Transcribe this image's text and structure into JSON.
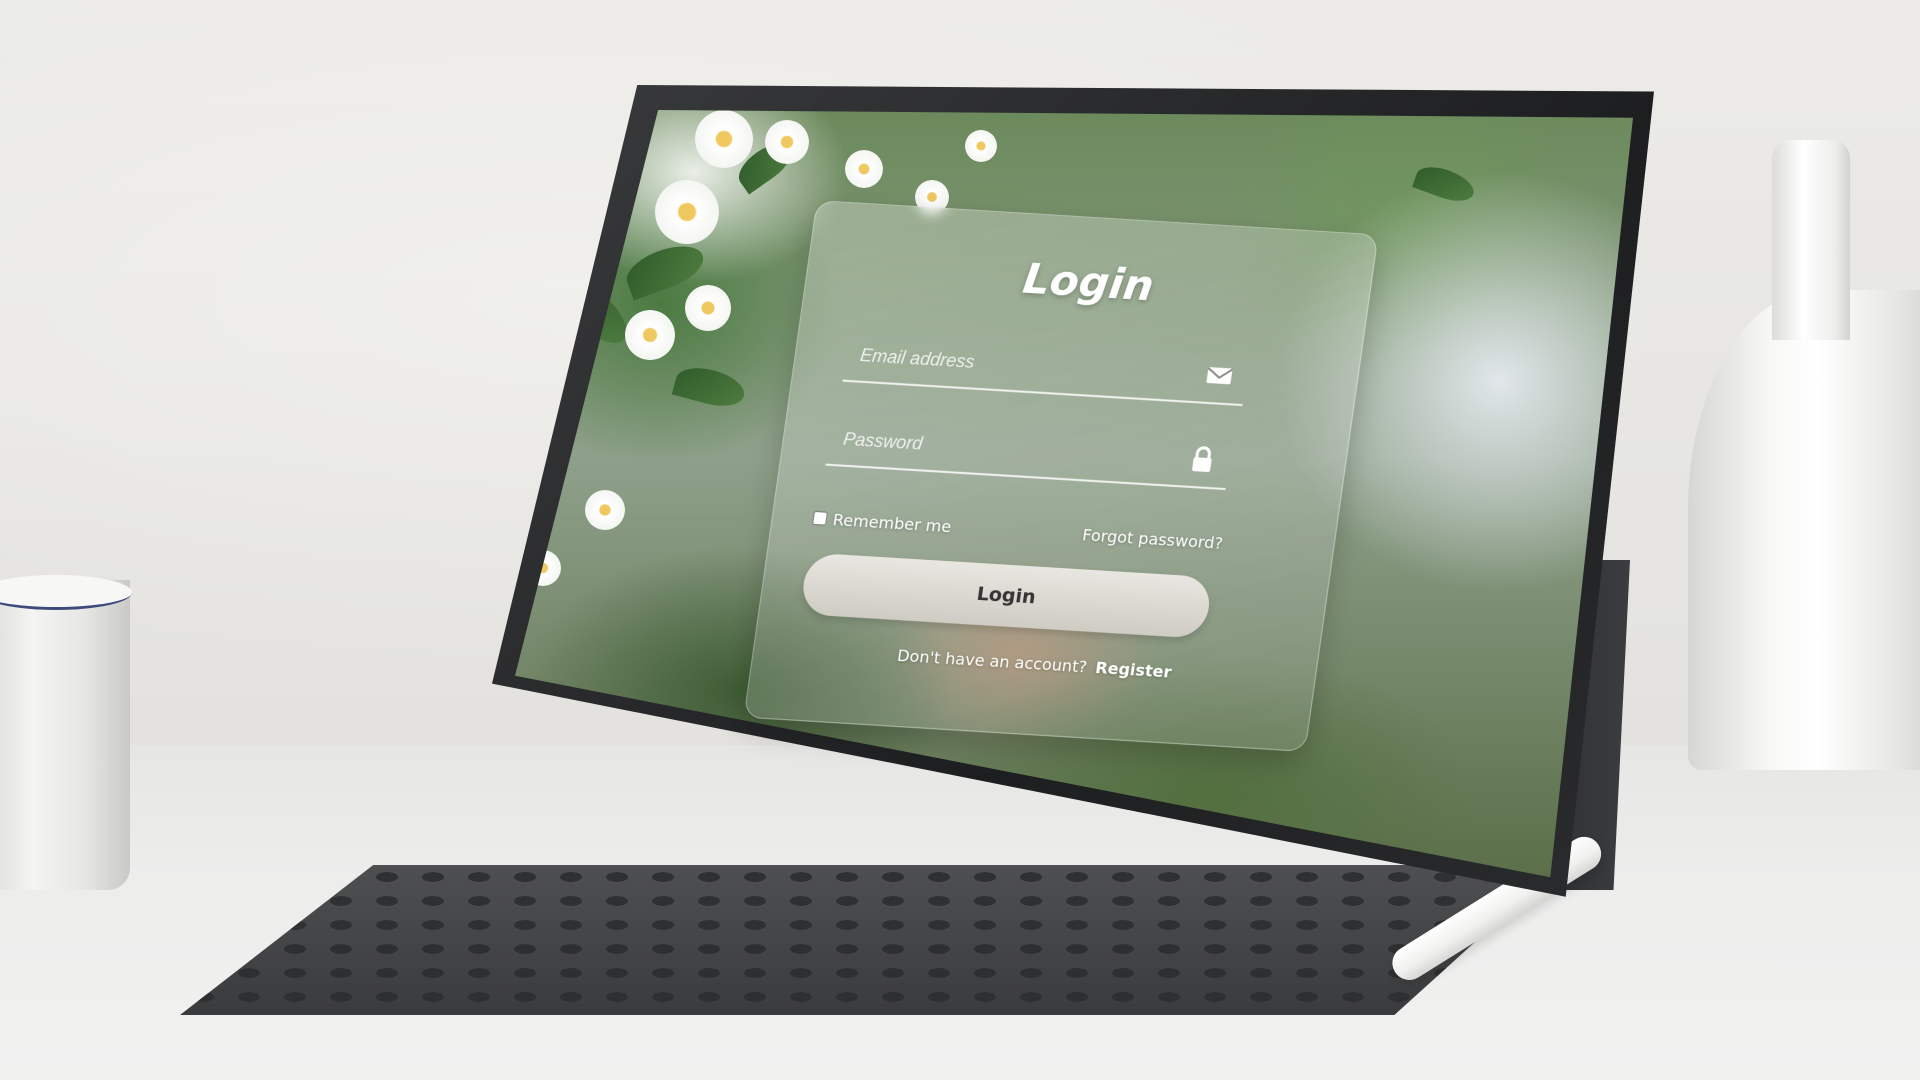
{
  "login": {
    "title": "Login",
    "email_placeholder": "Email address",
    "password_placeholder": "Password",
    "remember_label": "Remember me",
    "forgot_label": "Forgot password?",
    "button_label": "Login",
    "register_prompt": "Don't have an account?",
    "register_label": "Register"
  },
  "icons": {
    "email": "envelope-icon",
    "password": "lock-icon"
  },
  "colors": {
    "card_tint": "#ffffff",
    "button": "#dcd9d2",
    "button_text": "#333333"
  }
}
